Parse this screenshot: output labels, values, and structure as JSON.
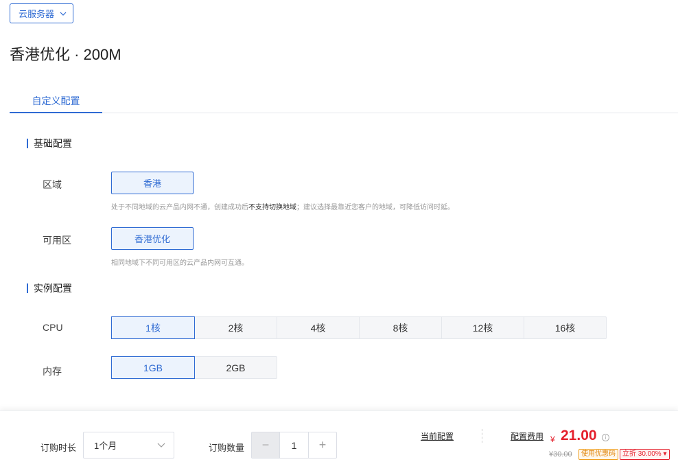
{
  "header": {
    "product_select": "云服务器",
    "title": "香港优化 · 200M"
  },
  "tabs": [
    {
      "label": "自定义配置",
      "active": true
    }
  ],
  "basic": {
    "section_title": "基础配置",
    "region": {
      "label": "区域",
      "selected": "香港",
      "hint_pre": "处于不同地域的云产品内网不通，创建成功后",
      "hint_bold": "不支持切换地域",
      "hint_post": "；建议选择最靠近您客户的地域，可降低访问时延。"
    },
    "zone": {
      "label": "可用区",
      "selected": "香港优化",
      "hint": "相同地域下不同可用区的云产品内网可互通。"
    }
  },
  "instance": {
    "section_title": "实例配置",
    "cpu": {
      "label": "CPU",
      "options": [
        "1核",
        "2核",
        "4核",
        "8核",
        "12核",
        "16核"
      ],
      "selected": "1核"
    },
    "memory": {
      "label": "内存",
      "options": [
        "1GB",
        "2GB"
      ],
      "selected": "1GB"
    }
  },
  "footer": {
    "duration_label": "订购时长",
    "duration_value": "1个月",
    "quantity_label": "订购数量",
    "quantity_value": "1",
    "minus": "−",
    "plus": "+",
    "current_config": "当前配置",
    "config_fee": "配置费用",
    "currency": "¥",
    "price": "21.00",
    "original_price": "¥30.00",
    "coupon": "使用优惠码",
    "discount": "立折 30.00%",
    "info": "i"
  },
  "colors": {
    "accent": "#2f6bd3",
    "price_red": "#e4202c",
    "coupon_orange": "#e0840a"
  }
}
